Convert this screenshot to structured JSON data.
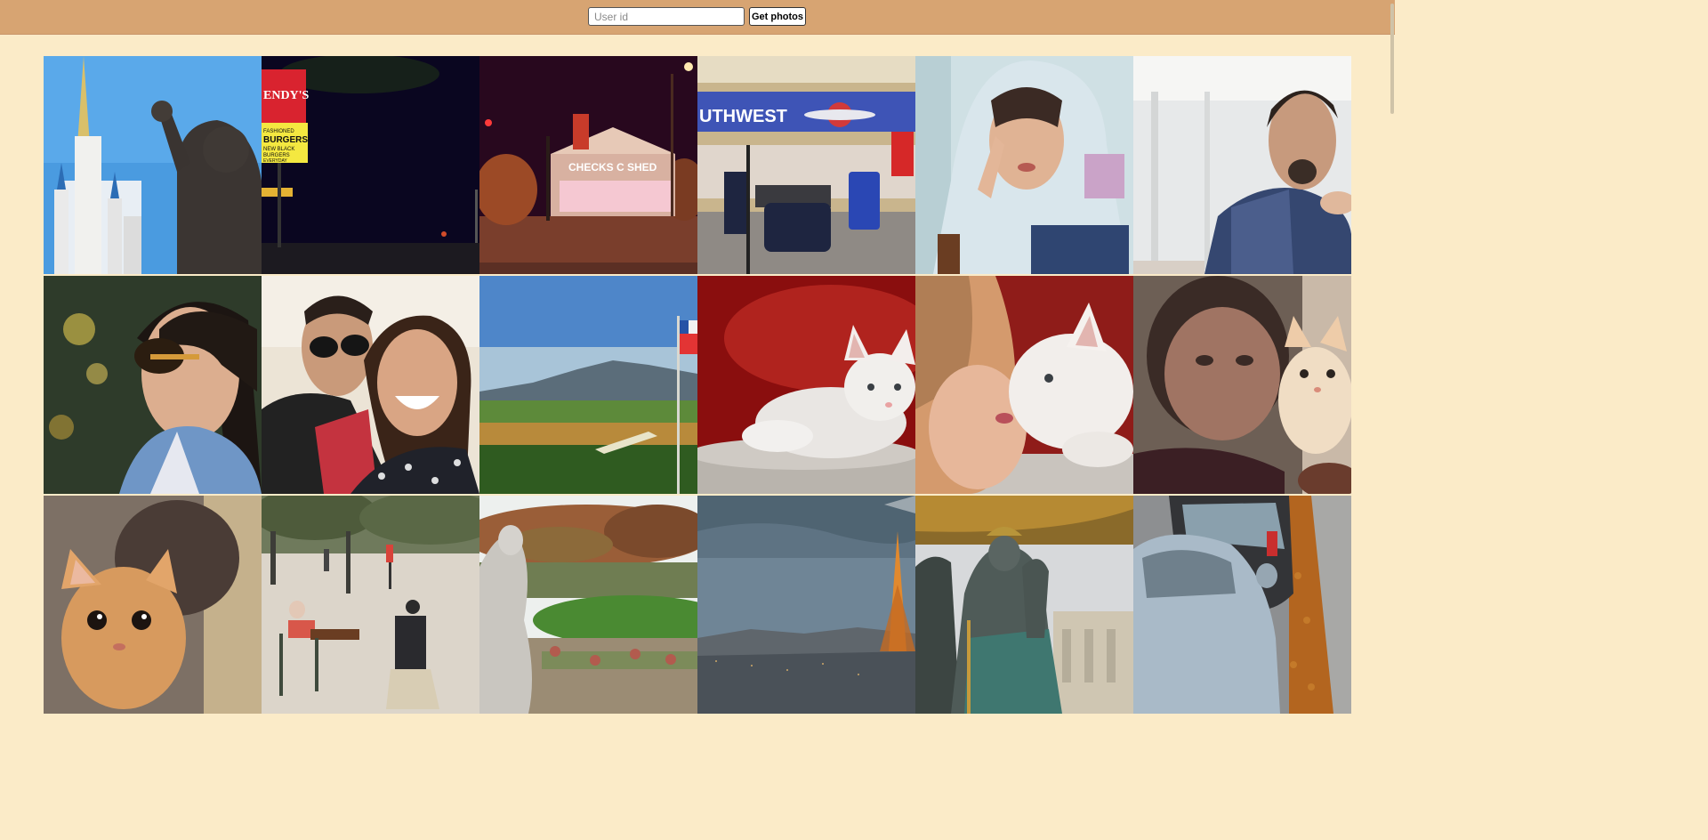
{
  "search": {
    "placeholder": "User id",
    "value": ""
  },
  "toolbar": {
    "get_label": "Get photos"
  },
  "photos": [
    {
      "name": "castle-statue",
      "alt": "Castle spires and bronze statue under blue sky"
    },
    {
      "name": "wendys-night",
      "alt": "Fast-food sign at night",
      "sign_text": "ENDY'S",
      "sign_lines": [
        "FASHIONED",
        "BURGERS",
        "NEW BLACK",
        "BURGERS",
        "EVERYDAY"
      ]
    },
    {
      "name": "checks-cashed-night",
      "alt": "Checks cashed store at night",
      "sign_text": "CHECKS C SHED"
    },
    {
      "name": "airport-counter",
      "alt": "Airline check-in counter with luggage",
      "sign_text": "UTHWEST"
    },
    {
      "name": "hooded-woman",
      "alt": "Woman in hoodie making hand sign"
    },
    {
      "name": "bearded-man",
      "alt": "Bearded man in plaid shirt"
    },
    {
      "name": "woman-sunglasses",
      "alt": "Woman with sunglasses and scarf"
    },
    {
      "name": "smiling-couple",
      "alt": "Smiling couple"
    },
    {
      "name": "flag-landscape",
      "alt": "Green valley landscape with flag"
    },
    {
      "name": "white-kitten",
      "alt": "White kitten lying down"
    },
    {
      "name": "woman-kitten",
      "alt": "Woman nuzzling white kitten"
    },
    {
      "name": "man-kitten",
      "alt": "Man holding cream kitten"
    },
    {
      "name": "orange-kitten",
      "alt": "Orange kitten close-up"
    },
    {
      "name": "park-chairs",
      "alt": "People sitting on chairs in park"
    },
    {
      "name": "garden-statue",
      "alt": "Statue in formal garden"
    },
    {
      "name": "eiffel-dusk",
      "alt": "Eiffel Tower at dusk over city"
    },
    {
      "name": "fountain-statues",
      "alt": "Green bronze fountain statues"
    },
    {
      "name": "parked-cars",
      "alt": "Parked cars on leafy street"
    }
  ]
}
